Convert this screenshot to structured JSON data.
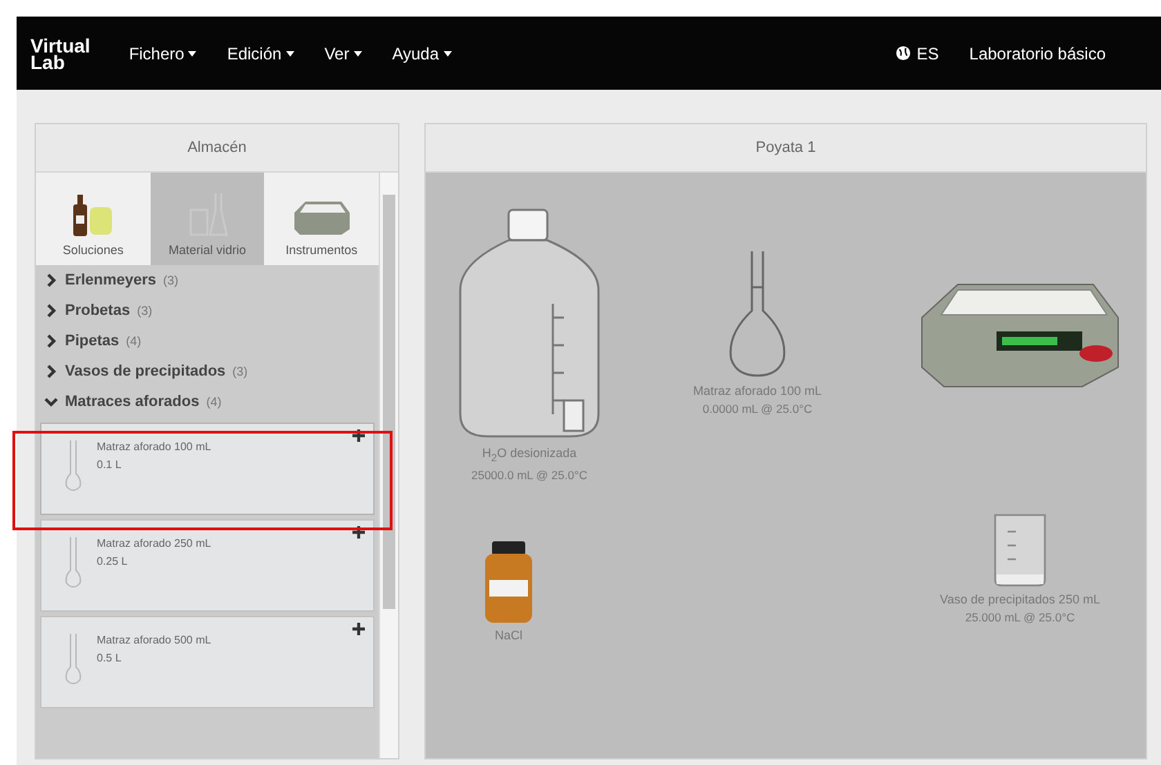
{
  "navbar": {
    "logo_top": "Virtual",
    "logo_bottom": "Lab",
    "menus": [
      {
        "label": "Fichero"
      },
      {
        "label": "Edición"
      },
      {
        "label": "Ver"
      },
      {
        "label": "Ayuda"
      }
    ],
    "language": "ES",
    "lab": "Laboratorio básico"
  },
  "store": {
    "title": "Almacén",
    "tabs": [
      {
        "label": "Soluciones",
        "kind": "solutions",
        "selected": false
      },
      {
        "label": "Material vidrio",
        "kind": "glass",
        "selected": true
      },
      {
        "label": "Instrumentos",
        "kind": "instruments",
        "selected": false
      }
    ],
    "categories": [
      {
        "name": "Erlenmeyers",
        "count": "(3)",
        "expanded": false
      },
      {
        "name": "Probetas",
        "count": "(3)",
        "expanded": false
      },
      {
        "name": "Pipetas",
        "count": "(4)",
        "expanded": false
      },
      {
        "name": "Vasos de precipitados",
        "count": "(3)",
        "expanded": false
      },
      {
        "name": "Matraces aforados",
        "count": "(4)",
        "expanded": true
      }
    ],
    "items": [
      {
        "name": "Matraz aforado 100 mL",
        "volume": "0.1 L",
        "highlighted": true
      },
      {
        "name": "Matraz aforado 250 mL",
        "volume": "0.25 L",
        "highlighted": false
      },
      {
        "name": "Matraz aforado 500 mL",
        "volume": "0.5 L",
        "highlighted": false
      }
    ]
  },
  "bench": {
    "title": "Poyata 1",
    "objects": [
      {
        "kind": "carboy",
        "name": "H$_{2}$O desionizada",
        "reading": "25000.0 mL @ 25.0°C"
      },
      {
        "kind": "flask",
        "name": "Matraz aforado 100 mL",
        "reading": "0.0000 mL @ 25.0°C"
      },
      {
        "kind": "balance"
      },
      {
        "kind": "reagent",
        "name": "NaCl"
      },
      {
        "kind": "beaker",
        "name": "Vaso de precipitados 250 mL",
        "reading": "25.000 mL @ 25.0°C"
      }
    ]
  }
}
